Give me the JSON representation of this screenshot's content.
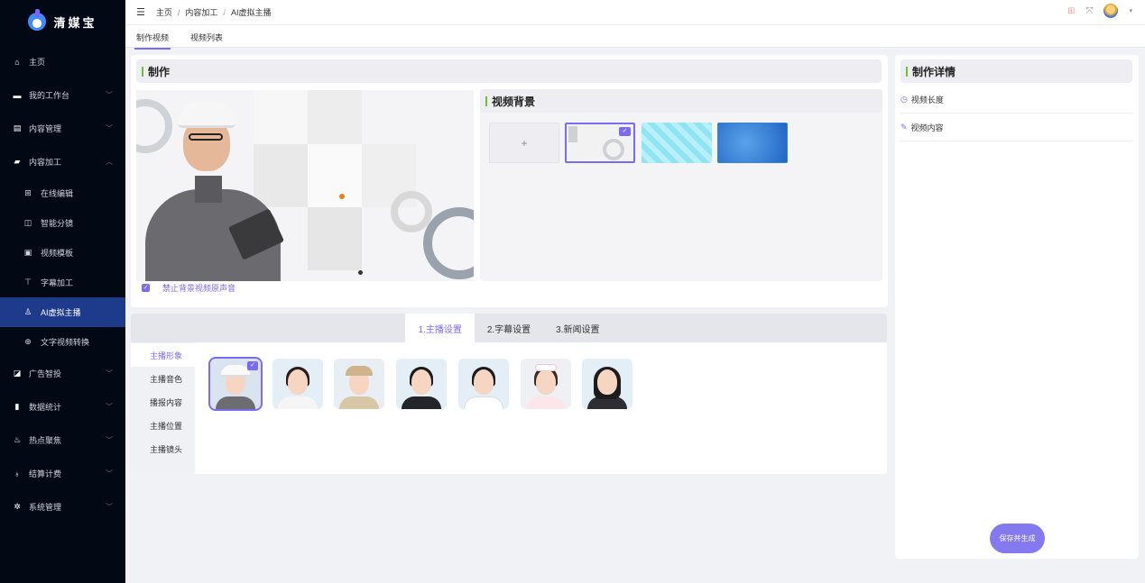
{
  "app": {
    "name": "清媒宝"
  },
  "sidebar": {
    "items": [
      {
        "label": "主页",
        "icon": "home-icon"
      },
      {
        "label": "我的工作台",
        "icon": "monitor-icon"
      },
      {
        "label": "内容管理",
        "icon": "document-icon"
      },
      {
        "label": "内容加工",
        "icon": "truck-icon",
        "expanded": true
      }
    ],
    "subitems": [
      {
        "label": "在线编辑",
        "icon": "grid-icon"
      },
      {
        "label": "智能分镜",
        "icon": "split-icon"
      },
      {
        "label": "视频模板",
        "icon": "template-icon"
      },
      {
        "label": "字幕加工",
        "icon": "text-icon"
      },
      {
        "label": "AI虚拟主播",
        "icon": "user-icon",
        "active": true
      },
      {
        "label": "文字视频转换",
        "icon": "convert-icon"
      }
    ],
    "items2": [
      {
        "label": "广告智投",
        "icon": "chart-icon"
      },
      {
        "label": "数据统计",
        "icon": "bar-chart-icon"
      },
      {
        "label": "热点聚焦",
        "icon": "fire-icon"
      },
      {
        "label": "结算计费",
        "icon": "money-bag-icon"
      },
      {
        "label": "系统管理",
        "icon": "gear-icon"
      }
    ]
  },
  "header": {
    "breadcrumb": [
      "主页",
      "内容加工",
      "AI虚拟主播"
    ]
  },
  "tabs": [
    {
      "label": "制作视频",
      "active": true
    },
    {
      "label": "视频列表",
      "active": false
    }
  ],
  "make": {
    "title": "制作",
    "mute_label": "禁止背景视频原声音",
    "mute_checked": true
  },
  "background": {
    "title": "视频背景",
    "add_label": "+",
    "selected_index": 0
  },
  "settings": {
    "tabs": [
      "1.主播设置",
      "2.字幕设置",
      "3.新闻设置"
    ],
    "active_tab": 0,
    "left_nav": [
      "主播形象",
      "主播音色",
      "播报内容",
      "主播位置",
      "主播镜头"
    ],
    "active_nav": 0,
    "selected_host": 0
  },
  "details": {
    "title": "制作详情",
    "rows": [
      {
        "label": "视频长度",
        "icon": "clock-icon"
      },
      {
        "label": "视频内容",
        "icon": "edit-icon"
      }
    ],
    "save_label": "保存并生成"
  },
  "colors": {
    "accent": "#7b6bf2",
    "sidebar_bg": "#020915",
    "active_nav_bg": "#1e3a8a",
    "section_bar": "#67c23a"
  }
}
